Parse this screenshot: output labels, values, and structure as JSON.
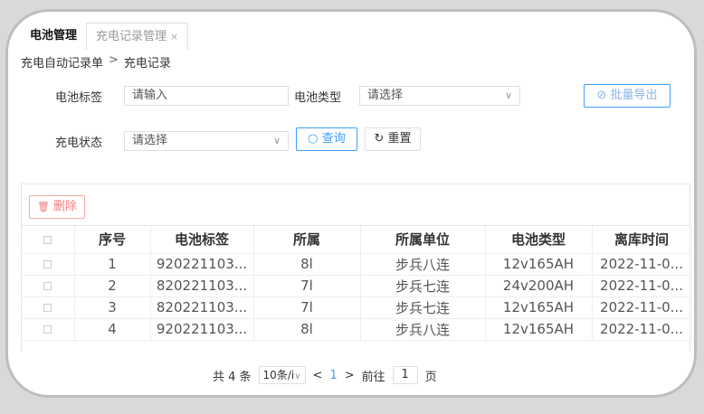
{
  "tabs": [
    {
      "label": "电池管理"
    },
    {
      "label": "充电记录管理",
      "close": "×"
    }
  ],
  "breadcrumb": {
    "parent": "充电自动记录单",
    "sep": ">",
    "current": "充电记录"
  },
  "form": {
    "battery_tag_label": "电池标签",
    "battery_tag_placeholder": "请输入",
    "battery_type_label": "电池类型",
    "battery_type_value": "请选择",
    "charge_state_label": "充电状态",
    "charge_state_value": "请选择",
    "query_button": "查询",
    "reset_button": "重置",
    "export_button": "批量导出"
  },
  "toolbar": {
    "delete_button": "删除"
  },
  "table": {
    "columns": [
      "序号",
      "电池标签",
      "所属",
      "所属单位",
      "电池类型",
      "离库时间"
    ],
    "rows": [
      [
        "1",
        "920221103...",
        "8l",
        "步兵八连",
        "12v165AH",
        "2022-11-0..."
      ],
      [
        "2",
        "820221103...",
        "7l",
        "步兵七连",
        "24v200AH",
        "2022-11-0..."
      ],
      [
        "3",
        "820221103...",
        "7l",
        "步兵七连",
        "12v165AH",
        "2022-11-0..."
      ],
      [
        "4",
        "920221103...",
        "8l",
        "步兵八连",
        "12v165AH",
        "2022-11-0..."
      ]
    ]
  },
  "pager": {
    "total": "共 4 条",
    "page_size": "10条/i",
    "prev": "<",
    "current_page": "1",
    "next": ">",
    "goto_label": "前往",
    "goto_value": "1",
    "page_unit": "页"
  },
  "icons": {
    "chevron": "∨",
    "export": "⊘",
    "search": "○",
    "reset": "↻",
    "trash": "🗑"
  }
}
